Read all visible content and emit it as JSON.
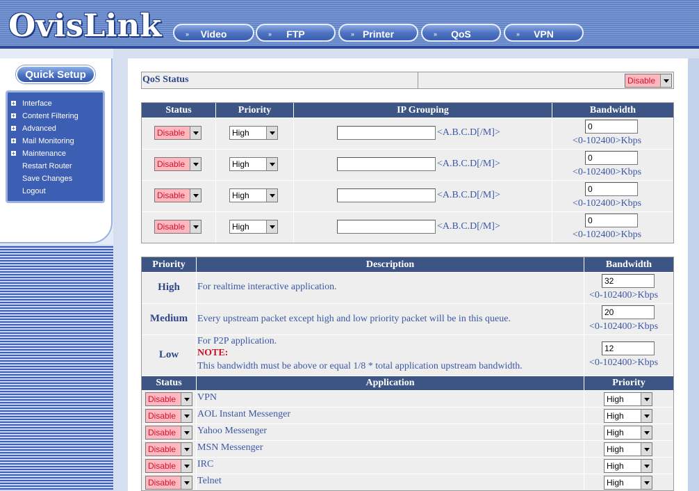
{
  "header": {
    "logo": "OvisLink",
    "nav": [
      "Video",
      "FTP",
      "Printer",
      "QoS",
      "VPN"
    ]
  },
  "sidebar": {
    "quick_setup": "Quick Setup",
    "items": [
      {
        "label": "Interface",
        "expandable": true
      },
      {
        "label": "Content Filtering",
        "expandable": true
      },
      {
        "label": "Advanced",
        "expandable": true
      },
      {
        "label": "Mail Monitoring",
        "expandable": true
      },
      {
        "label": "Maintenance",
        "expandable": true
      },
      {
        "label": "Restart Router",
        "expandable": false
      },
      {
        "label": "Save Changes",
        "expandable": false
      },
      {
        "label": "Logout",
        "expandable": false
      }
    ]
  },
  "qos_status": {
    "label": "QoS Status",
    "value": "Disable"
  },
  "ip_table": {
    "headers": [
      "Status",
      "Priority",
      "IP Grouping",
      "Bandwidth"
    ],
    "ip_hint": "<A.B.C.D[/M]>",
    "bw_hint": "<0-102400>Kbps",
    "rows": [
      {
        "status": "Disable",
        "priority": "High",
        "ip": "",
        "bandwidth": "0"
      },
      {
        "status": "Disable",
        "priority": "High",
        "ip": "",
        "bandwidth": "0"
      },
      {
        "status": "Disable",
        "priority": "High",
        "ip": "",
        "bandwidth": "0"
      },
      {
        "status": "Disable",
        "priority": "High",
        "ip": "",
        "bandwidth": "0"
      }
    ]
  },
  "priority_table": {
    "headers": [
      "Priority",
      "Description",
      "Bandwidth"
    ],
    "bw_hint": "<0-102400>Kbps",
    "rows": [
      {
        "priority": "High",
        "description": "For realtime interactive application.",
        "bandwidth": "32"
      },
      {
        "priority": "Medium",
        "description": "Every upstream packet except high and low priority packet will be in this queue.",
        "bandwidth": "20"
      },
      {
        "priority": "Low",
        "description": "For P2P application.",
        "note_label": "NOTE:",
        "note_text": "This bandwidth must be above or equal 1/8 * total application upstream bandwidth.",
        "bandwidth": "12"
      }
    ]
  },
  "app_table": {
    "headers": [
      "Status",
      "Application",
      "Priority"
    ],
    "rows": [
      {
        "status": "Disable",
        "application": "VPN",
        "priority": "High"
      },
      {
        "status": "Disable",
        "application": "AOL Instant Messenger",
        "priority": "High"
      },
      {
        "status": "Disable",
        "application": "Yahoo Messenger",
        "priority": "High"
      },
      {
        "status": "Disable",
        "application": "MSN Messenger",
        "priority": "High"
      },
      {
        "status": "Disable",
        "application": "IRC",
        "priority": "High"
      },
      {
        "status": "Disable",
        "application": "Telnet",
        "priority": "High"
      }
    ]
  },
  "colors": {
    "header_row": "#3c5584",
    "text_blue": "#3b58a6",
    "disable_bg": "#ffb7c0",
    "note_red": "#d0102a"
  }
}
